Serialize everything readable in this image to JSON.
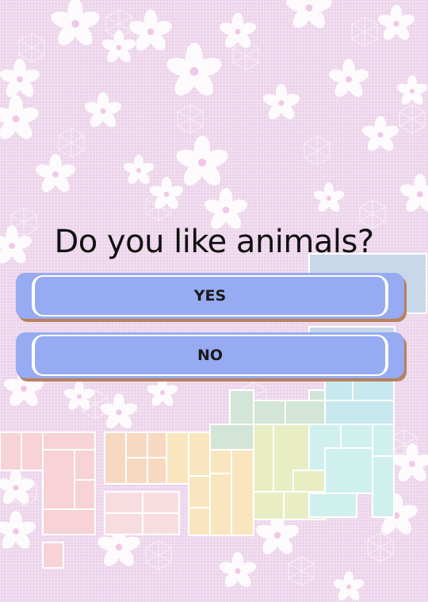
{
  "question": "Do you like animals?",
  "answers": {
    "yes_label": "YES",
    "no_label": "NO"
  },
  "colors": {
    "background": "#ecd3ea",
    "button_fill": "#96abf1",
    "button_shadow": "#b9815e",
    "text": "#111111"
  },
  "icons": {
    "background": "cherry-blossom-pattern",
    "map": "japan-region-map"
  }
}
